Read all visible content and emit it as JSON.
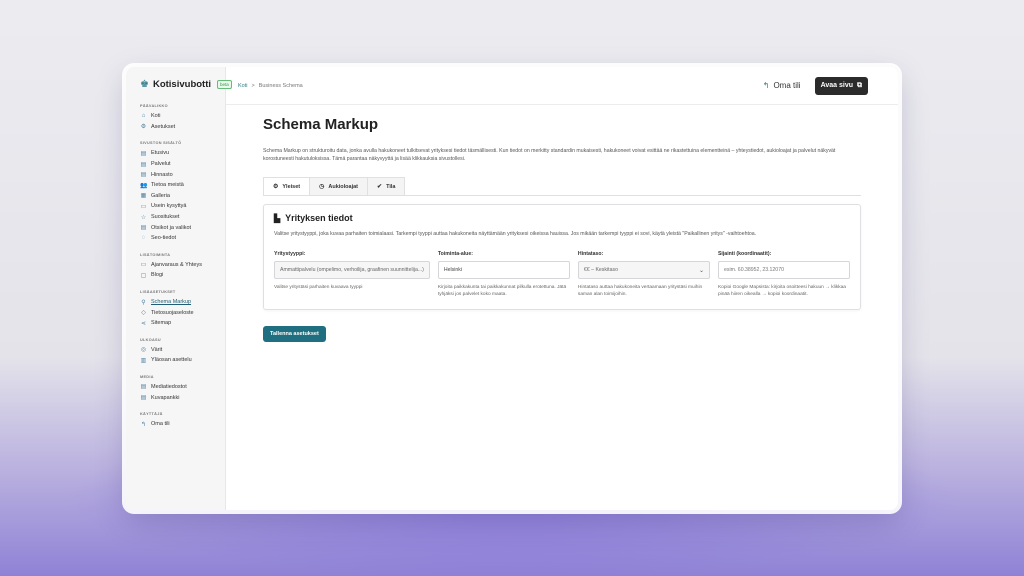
{
  "brand": {
    "name": "Kotisivubotti",
    "badge": "beta"
  },
  "sidebar": {
    "sections": [
      {
        "heading": "PÄÄVALIKKO",
        "items": [
          {
            "label": "Koti",
            "icon": "⌂"
          },
          {
            "label": "Asetukset",
            "icon": "⚙"
          }
        ]
      },
      {
        "heading": "SIVUSTON SISÄLTÖ",
        "items": [
          {
            "label": "Etusivu",
            "icon": "▤"
          },
          {
            "label": "Palvelut",
            "icon": "▤"
          },
          {
            "label": "Hinnasto",
            "icon": "▤"
          },
          {
            "label": "Tietoa meistä",
            "icon": "👥"
          },
          {
            "label": "Galleria",
            "icon": "▦"
          },
          {
            "label": "Usein kysyttyä",
            "icon": "▭"
          },
          {
            "label": "Suositukset",
            "icon": "☆"
          },
          {
            "label": "Otsikot ja valikot",
            "icon": "▤"
          },
          {
            "label": "Seo-tiedot",
            "icon": "◌"
          }
        ]
      },
      {
        "heading": "LISÄTOIMINTA",
        "items": [
          {
            "label": "Ajanvaraus & Yhteys",
            "icon": "▭"
          },
          {
            "label": "Blogi",
            "icon": "▢"
          }
        ]
      },
      {
        "heading": "LISÄASETUKSET",
        "items": [
          {
            "label": "Schema Markup",
            "icon": "⚲",
            "active": true
          },
          {
            "label": "Tietosuojaseloste",
            "icon": "◇"
          },
          {
            "label": "Sitemap",
            "icon": "⋖"
          }
        ]
      },
      {
        "heading": "ULKOASU",
        "items": [
          {
            "label": "Värit",
            "icon": "◎"
          },
          {
            "label": "Yläosan asettelu",
            "icon": "▥"
          }
        ]
      },
      {
        "heading": "MEDIA",
        "items": [
          {
            "label": "Mediatiedostot",
            "icon": "▤"
          },
          {
            "label": "Kuvapankki",
            "icon": "▤"
          }
        ]
      },
      {
        "heading": "KÄYTTÄJÄ",
        "items": [
          {
            "label": "Oma tili",
            "icon": "↰"
          }
        ]
      }
    ]
  },
  "topbar": {
    "breadcrumb_home": "Koti",
    "breadcrumb_sep": ">",
    "breadcrumb_current": "Business Schema",
    "account_label": "Oma tili",
    "open_site_label": "Avaa sivu"
  },
  "page": {
    "title": "Schema Markup",
    "intro": "Schema Markup on strukturoitu data, jonka avulla hakukoneet tulkitsevat yrityksesi tiedot täsmällisesti. Kun tiedot on merkitty standardin mukaisesti, hakukoneet voivat esittää ne rikastettuina elementteinä – yhteystiedot, aukioloajat ja palvelut näkyvät korostuneesti hakutuloksissa. Tämä parantaa näkyvyyttä ja lisää klikkauksia sivustollesi.",
    "tabs": [
      {
        "label": "Yleiset",
        "icon": "⚙",
        "active": true
      },
      {
        "label": "Aukioloajat",
        "icon": "◷"
      },
      {
        "label": "Tila",
        "icon": "✔"
      }
    ]
  },
  "card": {
    "title": "Yrityksen tiedot",
    "description": "Valitse yritystyyppi, joka kuvaa parhaiten toimialaasi. Tarkempi tyyppi auttaa hakukoneita näyttämään yrityksesi oikeissa hauissa. Jos mikään tarkempi tyyppi ei sovi, käytä yleistä \"Paikallinen yritys\" -vaihtoehtoa.",
    "fields": [
      {
        "label": "Yritystyyppi:",
        "value": "Ammattipalvelu (ompelimo, verhoilija, graafinen suunnittelija...)",
        "help": "Valitse yritystäsi parhaiten kuvaava tyyppi"
      },
      {
        "label": "Toiminta-alue:",
        "value": "Helsinki",
        "help": "Kirjoita paikkakunta tai paikkakunnat pilkulla erotettuna. Jätä tyhjäksi jos palvelet koko maata."
      },
      {
        "label": "Hintataso:",
        "value": "€€ – Keskitaso",
        "help": "Hintataso auttaa hakukoneita vertaamaan yritystäsi muihin saman alan toimijoihin."
      },
      {
        "label": "Sijainti (koordinaatit):",
        "placeholder": "esim. 60.38952, 23.12070",
        "help": "Kopioi Google Mapsista: kirjoita osoitteesi hakuun → klikkaa pinää hiiren oikealla → kopioi koordinaatit."
      }
    ]
  },
  "save_label": "Tallenna asetukset"
}
